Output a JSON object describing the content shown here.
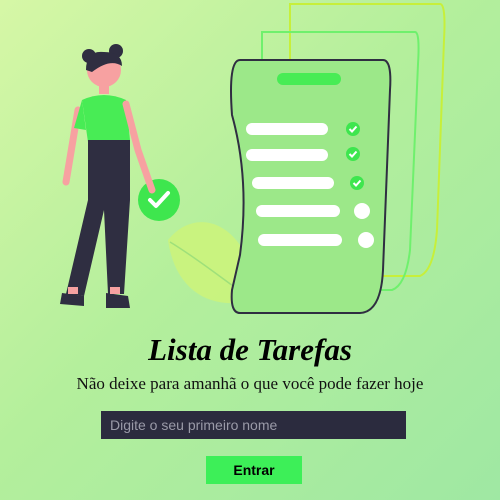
{
  "hero": {
    "title": "Lista de Tarefas",
    "subtitle": "Não deixe para amanhã o que você pode fazer hoje"
  },
  "form": {
    "name_placeholder": "Digite o seu primeiro nome",
    "name_value": "",
    "submit_label": "Entrar"
  },
  "colors": {
    "accent_green": "#3def58",
    "input_background": "#2b2b3e",
    "outline_dark": "#2f2e41"
  },
  "icons": [
    "woman-figure",
    "checkmark-badge-icon",
    "leaf",
    "task-list-document",
    "check-icon",
    "empty-circle-icon"
  ]
}
